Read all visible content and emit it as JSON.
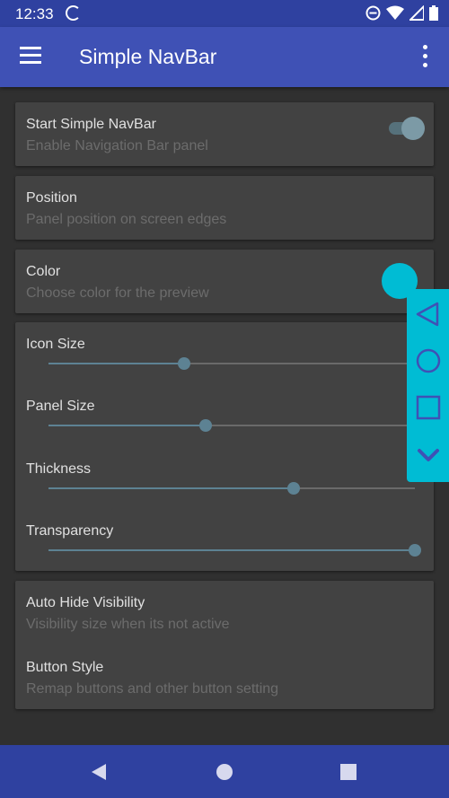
{
  "status_bar": {
    "time": "12:33",
    "icons": [
      "sync-icon",
      "do-not-disturb-icon",
      "wifi-icon",
      "signal-icon",
      "battery-icon"
    ]
  },
  "app_bar": {
    "title": "Simple NavBar",
    "menu_icon": "hamburger-menu-icon",
    "overflow_icon": "more-vert-icon",
    "color": "#3f51b5"
  },
  "preferences": {
    "start": {
      "title": "Start Simple NavBar",
      "summary": "Enable Navigation Bar panel",
      "enabled": true
    },
    "position": {
      "title": "Position",
      "summary": "Panel position on screen edges"
    },
    "color": {
      "title": "Color",
      "summary": "Choose color for the preview",
      "value": "#00bcd4"
    }
  },
  "sliders": [
    {
      "label": "Icon Size",
      "value": 0.37
    },
    {
      "label": "Panel Size",
      "value": 0.43
    },
    {
      "label": "Thickness",
      "value": 0.67
    },
    {
      "label": "Transparency",
      "value": 1.0
    }
  ],
  "more_preferences": {
    "auto_hide": {
      "title": "Auto Hide Visibility",
      "summary": "Visibility size when its not active"
    },
    "button_style": {
      "title": "Button Style",
      "summary": "Remap buttons and other button setting"
    }
  },
  "preview_panel": {
    "color": "#00bcd4",
    "buttons": [
      "back-triangle-icon",
      "home-circle-icon",
      "recents-square-icon",
      "collapse-chevron-icon"
    ]
  },
  "system_nav": {
    "buttons": [
      "back-icon",
      "home-icon",
      "recents-icon"
    ]
  }
}
